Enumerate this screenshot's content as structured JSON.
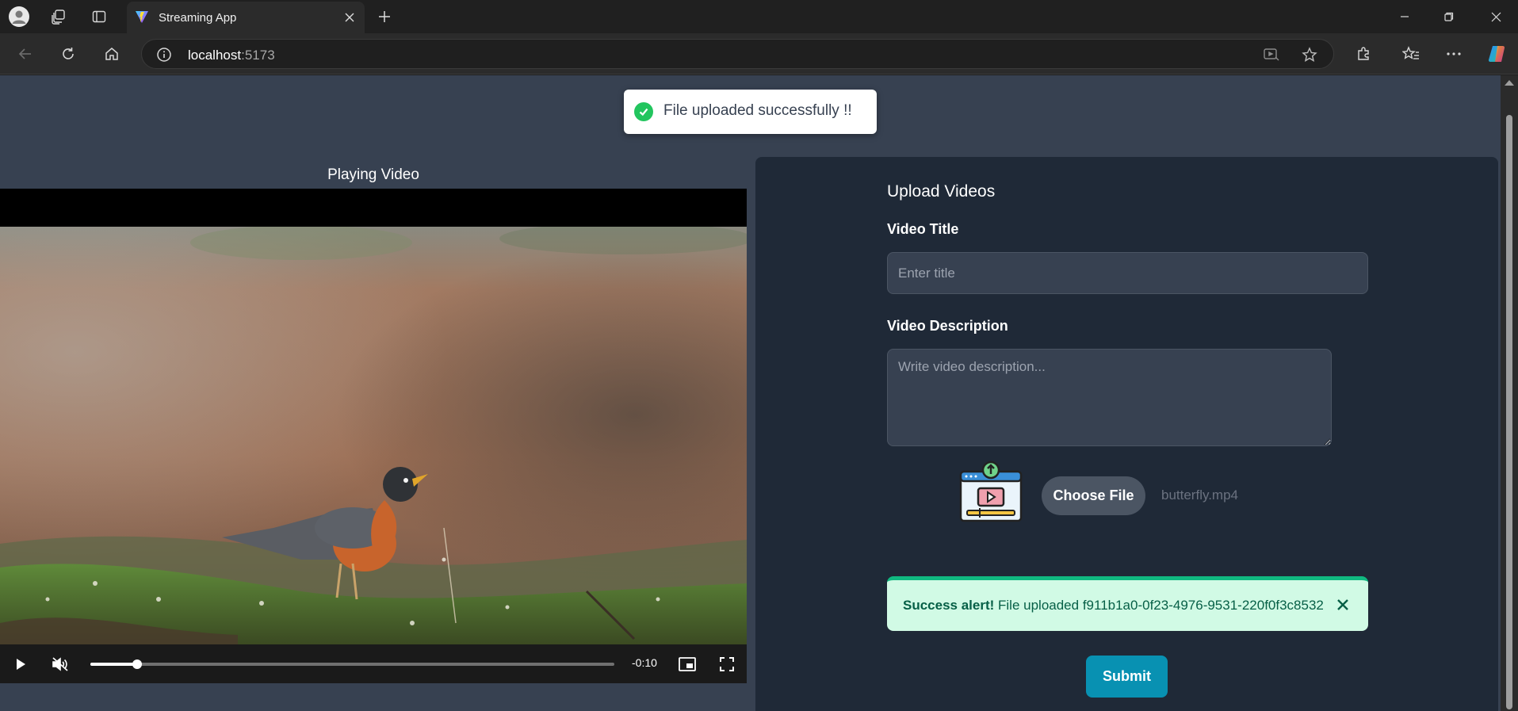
{
  "browser": {
    "tab_title": "Streaming App",
    "address_host": "localhost",
    "address_port": ":5173"
  },
  "toast": {
    "message": "File uploaded successfully !!"
  },
  "player": {
    "heading": "Playing Video",
    "time_remaining": "-0:10",
    "progress": 0.09,
    "muted": true
  },
  "upload_form": {
    "title": "Upload Videos",
    "title_label": "Video Title",
    "title_placeholder": "Enter title",
    "description_label": "Video Description",
    "description_placeholder": "Write video description...",
    "choose_file_label": "Choose File",
    "file_name": "butterfly.mp4",
    "alert_strong": "Success alert!",
    "alert_message": " File uploaded f911b1a0-0f23-4976-9531-220f0f3c8532",
    "submit_label": "Submit"
  },
  "colors": {
    "page_bg": "#374151",
    "panel_bg": "#1f2937",
    "success_green": "#22c55e",
    "alert_bg": "#d1fae5",
    "alert_text": "#065f46",
    "submit_bg": "#0891b2"
  },
  "icons": [
    "profile-icon",
    "workspaces-icon",
    "tab-actions-icon",
    "close-tab-icon",
    "new-tab-icon",
    "minimize-icon",
    "restore-icon",
    "close-window-icon",
    "back-icon",
    "reload-icon",
    "home-icon",
    "site-info-icon",
    "read-aloud-icon",
    "favorite-star-icon",
    "extensions-icon",
    "favorites-icon",
    "more-icon",
    "copilot-icon",
    "check-icon",
    "play-icon",
    "muted-icon",
    "pip-icon",
    "fullscreen-icon",
    "upload-video-icon",
    "alert-close-icon"
  ]
}
